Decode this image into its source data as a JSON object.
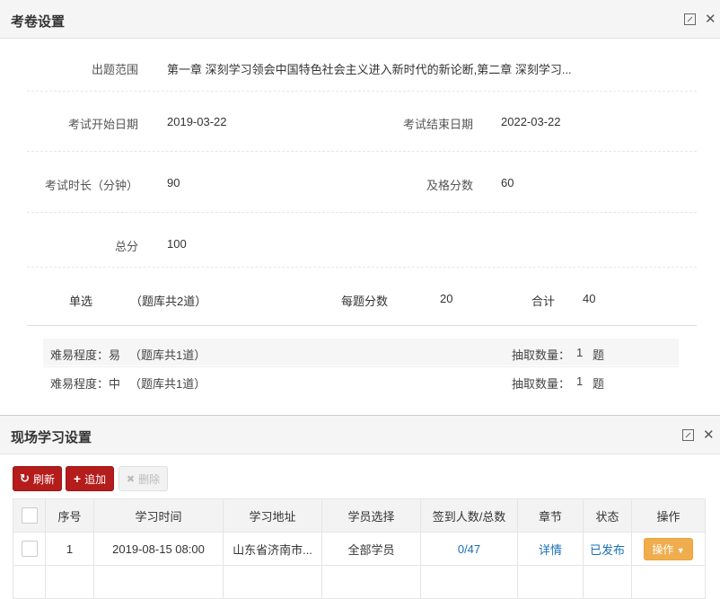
{
  "exam": {
    "title": "考卷设置",
    "scope_label": "出题范围",
    "scope_value": "第一章 深刻学习领会中国特色社会主义进入新时代的新论断,第二章 深刻学习...",
    "start_label": "考试开始日期",
    "start_value": "2019-03-22",
    "end_label": "考试结束日期",
    "end_value": "2022-03-22",
    "duration_label": "考试时长（分钟）",
    "duration_value": "90",
    "pass_label": "及格分数",
    "pass_value": "60",
    "total_label": "总分",
    "total_value": "100",
    "single_label": "单选",
    "single_bank": "（题库共2道）",
    "per_score_label": "每题分数",
    "per_score_value": "20",
    "sum_label": "合计",
    "sum_value": "40",
    "difficulty_rows": [
      {
        "level": "难易程度：易",
        "bank": "（题库共1道）",
        "pick_label": "抽取数量：",
        "pick_value": "1",
        "unit": "题"
      },
      {
        "level": "难易程度：中",
        "bank": "（题库共1道）",
        "pick_label": "抽取数量：",
        "pick_value": "1",
        "unit": "题"
      }
    ]
  },
  "study": {
    "title": "现场学习设置",
    "buttons": {
      "refresh": "刷新",
      "add": "追加",
      "delete": "删除"
    },
    "columns": [
      "序号",
      "学习时间",
      "学习地址",
      "学员选择",
      "签到人数/总数",
      "章节",
      "状态",
      "操作"
    ],
    "rows": [
      {
        "index": "1",
        "time": "2019-08-15 08:00",
        "address": "山东省济南市...",
        "students": "全部学员",
        "signin": "0/47",
        "chapter": "详情",
        "status": "已发布",
        "action": "操作"
      }
    ]
  },
  "icons": {
    "maximize": "maximize-icon",
    "close": "close-icon",
    "refresh": "refresh-icon",
    "add": "plus-icon",
    "delete": "x-icon"
  },
  "colors": {
    "primary_red": "#b51c1c",
    "link_blue": "#1a6fb5",
    "action_orange": "#f0ad4e"
  }
}
